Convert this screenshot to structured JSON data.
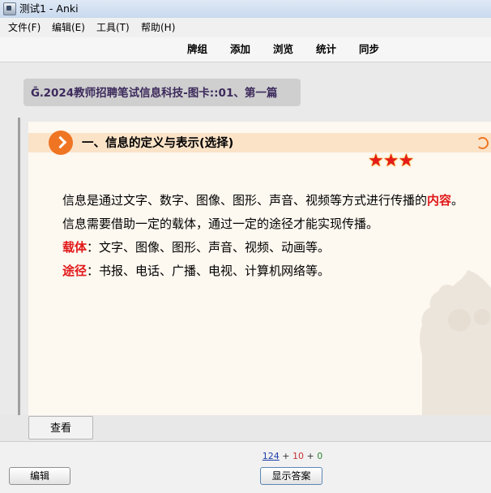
{
  "window": {
    "title": "测试1 - Anki"
  },
  "menu": [
    "文件(F)",
    "编辑(E)",
    "工具(T)",
    "帮助(H)"
  ],
  "toolbar": [
    "牌组",
    "添加",
    "浏览",
    "统计",
    "同步"
  ],
  "deck": {
    "name": "Ḡ․2024教师招聘笔试信息科技-图卡::01、第一篇"
  },
  "card": {
    "section_title": "一、信息的定义与表示(选择)",
    "stars": "★★★",
    "line1_text": "信息是通过文字、数字、图像、图形、声音、视频等方式进行传播的",
    "line1_keyword": "内容",
    "line1_end": "。",
    "line2_text": "信息需要借助一定的载体，通过一定的途径才能实现传播。",
    "line3_keyword": "载体",
    "line3_text": "：文字、图像、图形、声音、视频、动画等。",
    "line4_keyword": "途径",
    "line4_text": "：书报、电话、广播、电视、计算机网络等。"
  },
  "view_button": "查看",
  "counts": {
    "new": "124",
    "learn": "10",
    "review": "0",
    "sep": "+"
  },
  "bottom": {
    "edit_button": "编辑",
    "show_answer_button": "显示答案"
  },
  "colors": {
    "accent": "#ef7523",
    "keyword": "#e11919",
    "deck_text": "#3c2a5c"
  }
}
